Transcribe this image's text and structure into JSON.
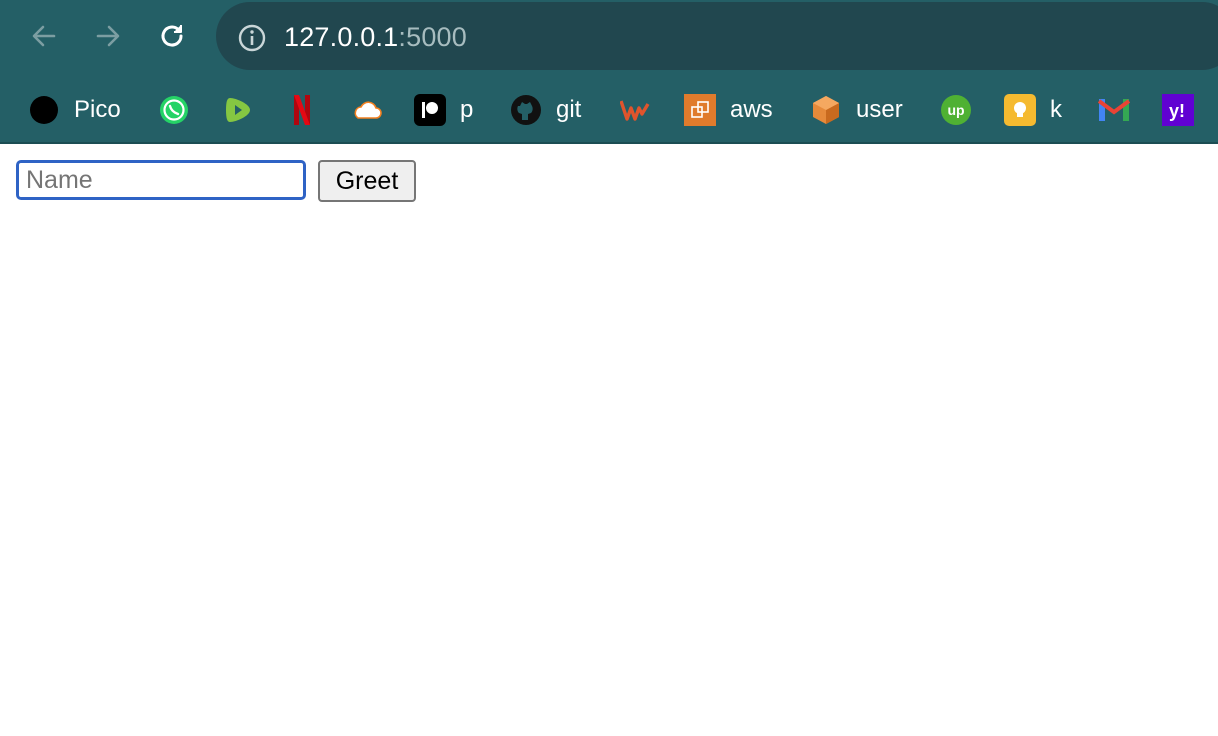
{
  "browser": {
    "address": {
      "host": "127.0.0.1",
      "port": ":5000"
    },
    "nav": {
      "back_icon": "arrow-left-icon",
      "forward_icon": "arrow-right-icon",
      "reload_icon": "reload-icon",
      "info_icon": "info-icon"
    },
    "colors": {
      "toolbar": "#245f66",
      "omnibox": "#21474f"
    }
  },
  "bookmarks": [
    {
      "label": "Pico",
      "icon": "black-circle-icon"
    },
    {
      "label": "",
      "icon": "whatsapp-icon"
    },
    {
      "label": "",
      "icon": "rumble-icon"
    },
    {
      "label": "",
      "icon": "netflix-icon"
    },
    {
      "label": "",
      "icon": "cloud-icon"
    },
    {
      "label": "p",
      "icon": "patreon-icon"
    },
    {
      "label": "git",
      "icon": "github-icon"
    },
    {
      "label": "",
      "icon": "wr-logo-icon"
    },
    {
      "label": "aws",
      "icon": "aws-icon"
    },
    {
      "label": "user",
      "icon": "orange-cube-icon"
    },
    {
      "label": "",
      "icon": "upwork-icon"
    },
    {
      "label": "k",
      "icon": "lightbulb-icon"
    },
    {
      "label": "",
      "icon": "gmail-icon"
    },
    {
      "label": "",
      "icon": "yahoo-icon"
    }
  ],
  "form": {
    "name_placeholder": "Name",
    "name_value": "",
    "greet_label": "Greet"
  }
}
